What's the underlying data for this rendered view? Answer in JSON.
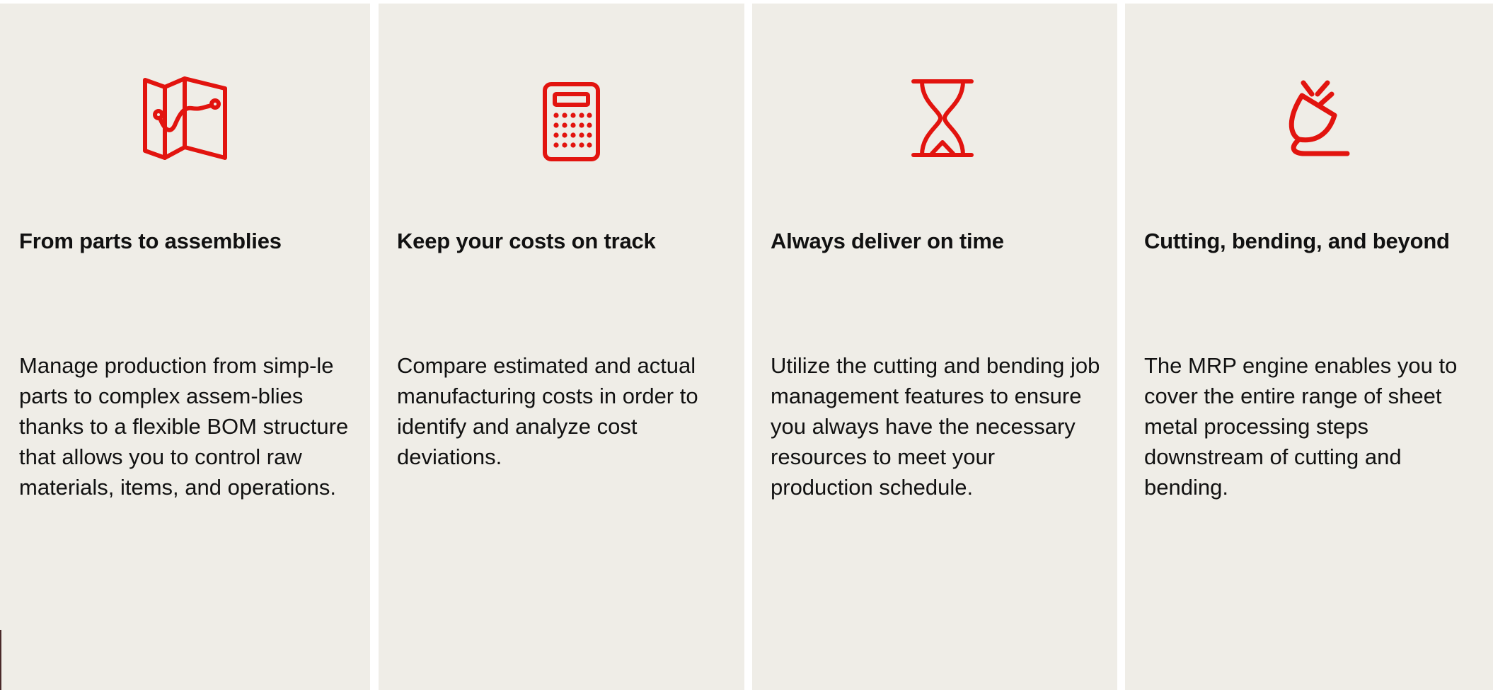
{
  "colors": {
    "card_background": "#efede7",
    "icon_red": "#e2140f",
    "text": "#111111"
  },
  "features": [
    {
      "icon": "map-route-icon",
      "title": "From parts to assemblies",
      "description": "Manage production from simp-le parts to complex assem-blies thanks to a flexible BOM structure that allows you to control raw materials, items, and operations."
    },
    {
      "icon": "calculator-icon",
      "title": "Keep your costs on track",
      "description": "Compare estimated and actual manufacturing costs in order to identify and analyze cost deviations."
    },
    {
      "icon": "hourglass-icon",
      "title": "Always deliver on time",
      "description": "Utilize the cutting and bending job management features to ensure you always have the necessary resources to meet your production schedule."
    },
    {
      "icon": "plug-icon",
      "title": "Cutting, bending, and beyond",
      "description": "The MRP engine enables you to cover the entire range of sheet metal processing steps downstream of cutting and bending."
    }
  ]
}
